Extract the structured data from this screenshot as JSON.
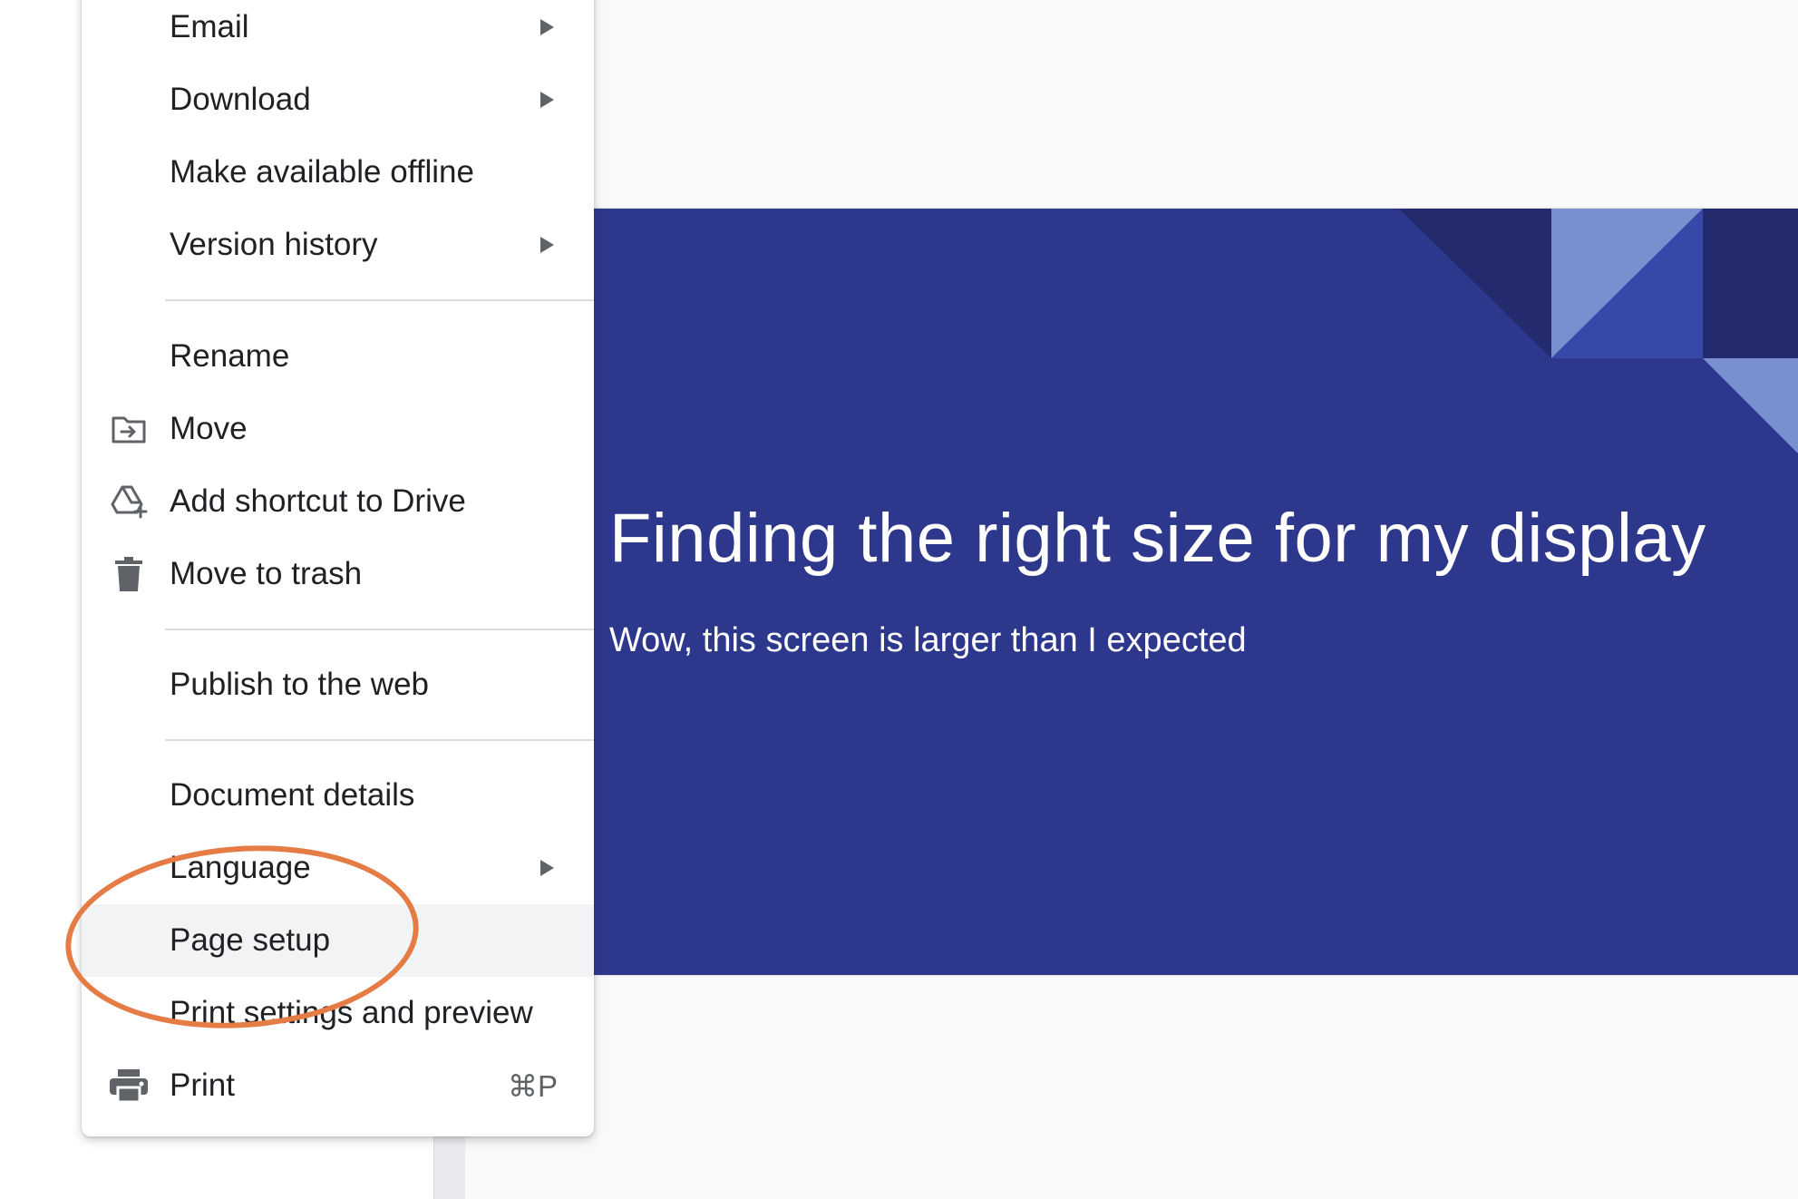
{
  "menu": {
    "items": [
      {
        "id": "email",
        "label": "Email",
        "submenu": true
      },
      {
        "id": "download",
        "label": "Download",
        "submenu": true
      },
      {
        "id": "offline",
        "label": "Make available offline",
        "submenu": false
      },
      {
        "id": "version-history",
        "label": "Version history",
        "submenu": true
      },
      {
        "id": "rename",
        "label": "Rename",
        "submenu": false
      },
      {
        "id": "move",
        "label": "Move",
        "icon": "folder-move-icon",
        "submenu": false
      },
      {
        "id": "shortcut",
        "label": "Add shortcut to Drive",
        "icon": "drive-add-shortcut-icon",
        "submenu": false
      },
      {
        "id": "trash",
        "label": "Move to trash",
        "icon": "trash-icon",
        "submenu": false
      },
      {
        "id": "publish",
        "label": "Publish to the web",
        "submenu": false
      },
      {
        "id": "details",
        "label": "Document details",
        "submenu": false
      },
      {
        "id": "language",
        "label": "Language",
        "submenu": true
      },
      {
        "id": "page-setup",
        "label": "Page setup",
        "submenu": false,
        "highlighted": true
      },
      {
        "id": "print-preview",
        "label": "Print settings and preview",
        "submenu": false
      },
      {
        "id": "print",
        "label": "Print",
        "icon": "printer-icon",
        "shortcut": "⌘P",
        "submenu": false
      }
    ]
  },
  "slide": {
    "title": "Finding the right size for my display",
    "subtitle": "Wow, this screen is larger than I expected",
    "background": "#2d378c"
  },
  "colors": {
    "annotation": "#e67c45",
    "highlight": "#f1f3f4",
    "slide_dark": "#232b6e",
    "slide_mid": "#3848a8",
    "slide_light": "#7a8fd0"
  }
}
